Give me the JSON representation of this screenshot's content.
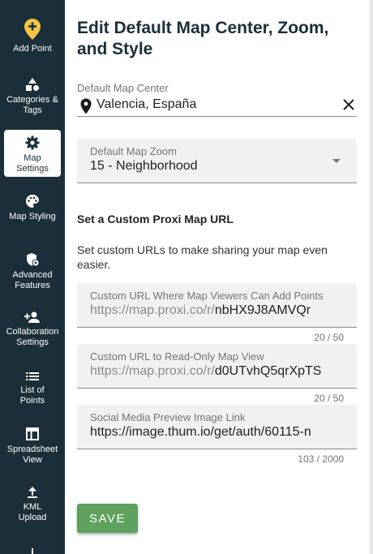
{
  "sidebar": {
    "items": [
      {
        "label": "Add Point"
      },
      {
        "label": "Categories & Tags"
      },
      {
        "label": "Map Settings"
      },
      {
        "label": "Map Styling"
      },
      {
        "label": "Advanced Features"
      },
      {
        "label": "Collaboration Settings"
      },
      {
        "label": "List of Points"
      },
      {
        "label": "Spreadsheet View"
      },
      {
        "label": "KML Upload"
      }
    ],
    "active_item": "Map Settings",
    "colors": {
      "background": "#1a2f3a",
      "accent": "#f4c542"
    }
  },
  "main": {
    "title": "Edit Default Map Center, Zoom, and Style",
    "map_center": {
      "label": "Default Map Center",
      "value": "Valencia, España"
    },
    "map_zoom": {
      "label": "Default Map Zoom",
      "value": "15 - Neighborhood"
    },
    "custom_url_section": {
      "title": "Set a Custom Proxi Map URL",
      "description": "Set custom URLs to make sharing your map even easier."
    },
    "add_points_url": {
      "label": "Custom URL Where Map Viewers Can Add Points",
      "prefix": "https://map.proxi.co/r/",
      "value": "nbHX9J8AMVQr",
      "counter": "20 / 50"
    },
    "readonly_url": {
      "label": "Custom URL to Read-Only Map View",
      "prefix": "https://map.proxi.co/r/",
      "value": "d0UTvhQ5qrXpTS",
      "counter": "20 / 50"
    },
    "social_preview": {
      "label": "Social Media Preview Image Link",
      "value": "https://image.thum.io/get/auth/60115-n",
      "counter": "103 / 2000"
    },
    "save_label": "SAVE",
    "colors": {
      "save_button": "#5fa15e",
      "title": "#1a2f3a"
    }
  }
}
